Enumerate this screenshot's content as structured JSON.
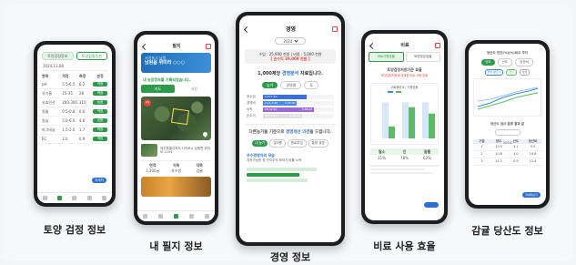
{
  "captions": {
    "soil": "토양 검정 정보",
    "field": "내 필지 정보",
    "management": "경영 정보",
    "fertilizer": "비료 사용 효율",
    "sugar": "감귤 당산도 정보"
  },
  "phone3": {
    "title": "경영",
    "year": "2024",
    "summary_line1": "수입 : 25,900 천원 | 비용 : 5,000 천원",
    "summary_line2": "[ 순수익 20,000 천원 ]",
    "headline_prefix": "1,000제당",
    "headline_highlight": "경영분석",
    "headline_suffix": "자료입니다.",
    "tabs": [
      "농가",
      "경영원",
      "도"
    ],
    "bars": [
      {
        "label": "조수입",
        "value1": "5,577,50",
        "value2": ""
      },
      {
        "label": "경영비",
        "value1": "13,1,5,90",
        "value2": "5,35,90"
      },
      {
        "label": "소득",
        "value1": "18,32,50",
        "value2": "5,68,00"
      },
      {
        "label": "순수익",
        "value1": "19,18,90",
        "value2": "5,42,78"
      }
    ],
    "section2_prefix": "다른농가들 기준으로",
    "section2_highlight": "경영개선 의견",
    "section2_suffix": "을 드립니다.",
    "chips": [
      "내 농가",
      "잎다름",
      "원료투입",
      "통합 경영"
    ],
    "advice_title": "우수경영자의 모습",
    "advice_text": "지속가능한 창 관리수익 뿌리기 비를 노력"
  },
  "phone4": {
    "title": "비료",
    "tabs": [
      "비료사용효율",
      "토양양분효율"
    ],
    "headline": "토양검정처방기준 효율",
    "subline": "토양검정처방과 비교한 비료 사용 효율",
    "chart_title": "비료량비교 / 사용효율",
    "bars": [
      {
        "label": "질소",
        "value": 30
      },
      {
        "label": "인산",
        "value": 78
      },
      {
        "label": "칼리",
        "value": 62
      }
    ],
    "table_headers": [
      "질소",
      "인",
      "칼륨"
    ],
    "table_values": [
      "31%",
      "78%",
      "62%"
    ]
  },
  "phone5": {
    "title": "당산도 연간(%)(%)비교 추이",
    "tabs": [
      "당도",
      "산도",
      "당산비"
    ],
    "legend": [
      "올해 평균 1",
      "전년",
      "평년"
    ],
    "table_title": "당산도 검사 분류 결과 값",
    "year": "2024",
    "table_headers": [
      "구분",
      "당도",
      "산도",
      "당산비"
    ],
    "table_rows": [
      [
        "1",
        "10.5",
        "1.1",
        "9.5"
      ],
      [
        "2",
        "10.8",
        "1.0",
        "10.8"
      ],
      [
        "3",
        "11.2",
        "0.9",
        "12.4"
      ]
    ],
    "more": "자세히보기"
  },
  "phone1": {
    "tabs": [
      "토양검정정보",
      "토양검정추천"
    ],
    "date": "2024.11.08",
    "table_headers": [
      "항목",
      "적정",
      "측정",
      "판정"
    ],
    "rows": [
      [
        "pH",
        "5.5-6.5",
        "6.2",
        "적정"
      ],
      [
        "유기물",
        "25-35",
        "28",
        "적정"
      ],
      [
        "유효인산",
        "200-300",
        "310",
        "높음"
      ],
      [
        "칼륨",
        "0.5-0.8",
        "0.6",
        "적정"
      ],
      [
        "칼슘",
        "5.0-6.0",
        "4.8",
        "낮음"
      ],
      [
        "마그네슘",
        "1.5-2.0",
        "1.7",
        "적정"
      ],
      [
        "EC",
        "2.0",
        "0.9",
        "적정"
      ]
    ],
    "more": "자세히"
  },
  "phone2": {
    "title": "필지",
    "banner_line1": "서귀포시 남원",
    "banner_line2": "남원읍 위미리 ○○○",
    "notice": "내 농장정보를 기록되었습니다.",
    "tabs": [
      "지도",
      "사진"
    ],
    "badge": "지목",
    "field_text": "제주특별자치도 서귀포시 남원면 위미리 1234",
    "table_headers": [
      "면적",
      "지목",
      "작목"
    ],
    "table_values": [
      "3,300㎡",
      "과수원",
      "감귤"
    ]
  }
}
